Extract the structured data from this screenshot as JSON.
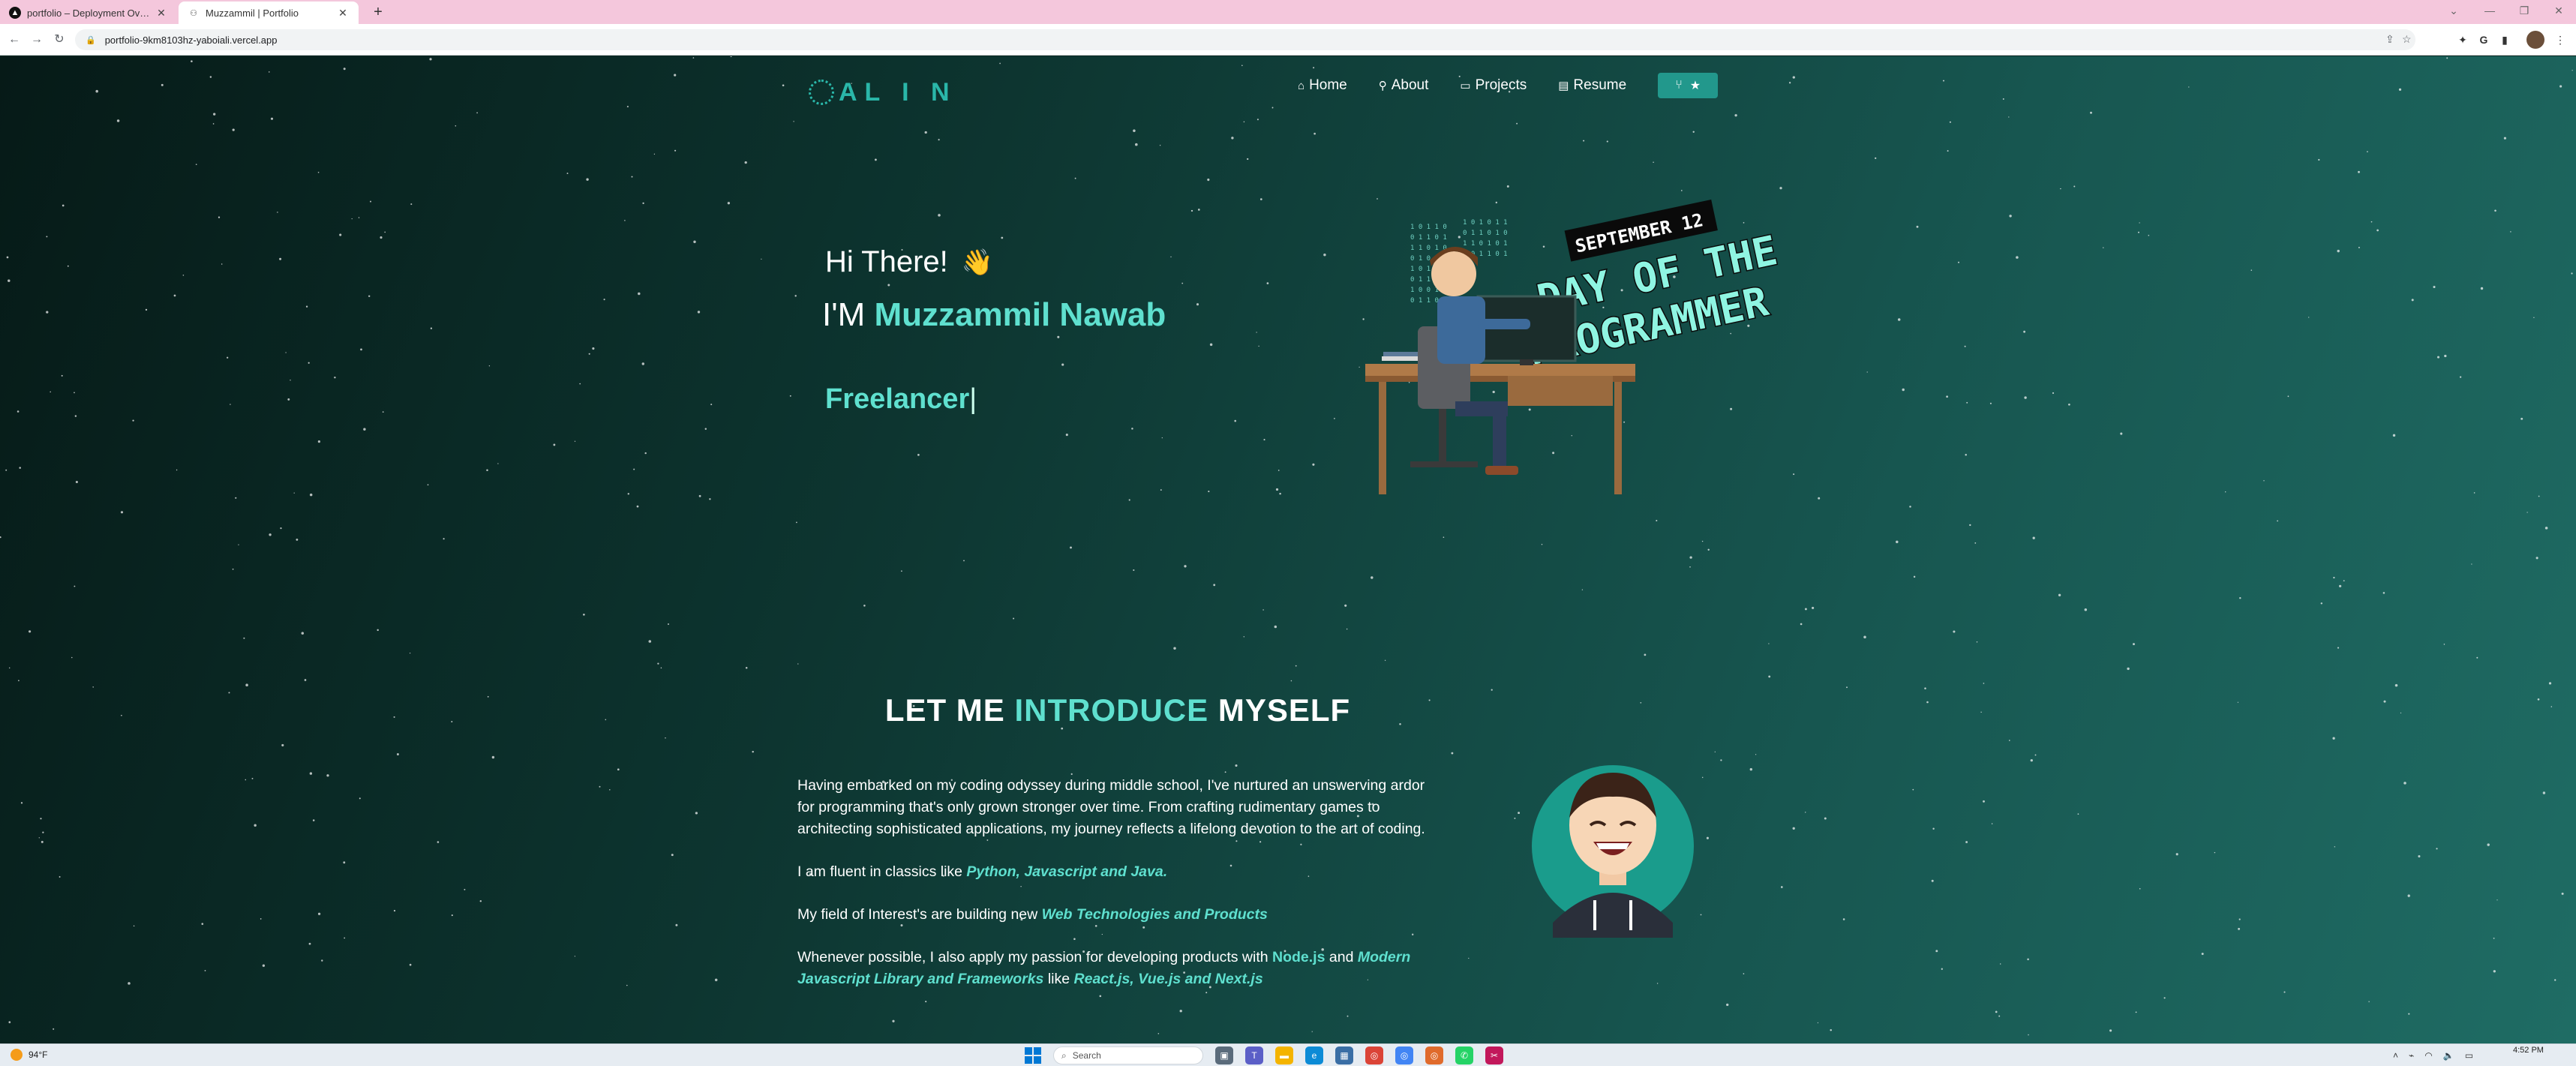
{
  "browser": {
    "tabs": [
      {
        "title": "portfolio – Deployment Overview",
        "active": false
      },
      {
        "title": "Muzzammil | Portfolio",
        "active": true
      }
    ],
    "url": "portfolio-9km8103hz-yaboiali.vercel.app"
  },
  "site": {
    "logo_text": "AL I  N",
    "nav": [
      {
        "label": "Home",
        "icon": "home-icon"
      },
      {
        "label": "About",
        "icon": "user-icon"
      },
      {
        "label": "Projects",
        "icon": "projects-icon"
      },
      {
        "label": "Resume",
        "icon": "document-icon"
      }
    ],
    "accent": "#5fe0cf"
  },
  "hero": {
    "greeting": "Hi There!",
    "iam_prefix": "I'M",
    "name": "Muzzammil Nawab",
    "typed_role": "Freelancer",
    "art_text_1": "SEPTEMBER 12",
    "art_text_2": "DAY OF THE",
    "art_text_3": "PROGRAMMER"
  },
  "intro": {
    "title_part1": "LET ME",
    "title_highlight": "INTRODUCE",
    "title_part2": "MYSELF",
    "p1": "Having embarked on my coding odyssey during middle school, I've nurtured an unswerving ardor for programming that's only grown stronger over time. From crafting rudimentary games to architecting sophisticated applications, my journey reflects a lifelong devotion to the art of coding.",
    "p2_text": "I am fluent in classics like",
    "p2_em": "Python, Javascript and Java.",
    "p3_text": "My field of Interest's are building new",
    "p3_em": "Web Technologies and Products",
    "p4_text": "Whenever possible, I also apply my passion for developing products with",
    "p4_acc": "Node.js",
    "p4_and": "and",
    "p4_em1": "Modern Javascript Library and Frameworks",
    "p4_like": "like",
    "p4_em2": "React.js, Vue.js and Next.js"
  },
  "taskbar": {
    "weather": "94°F",
    "search_placeholder": "Search",
    "time": "4:52 PM"
  }
}
